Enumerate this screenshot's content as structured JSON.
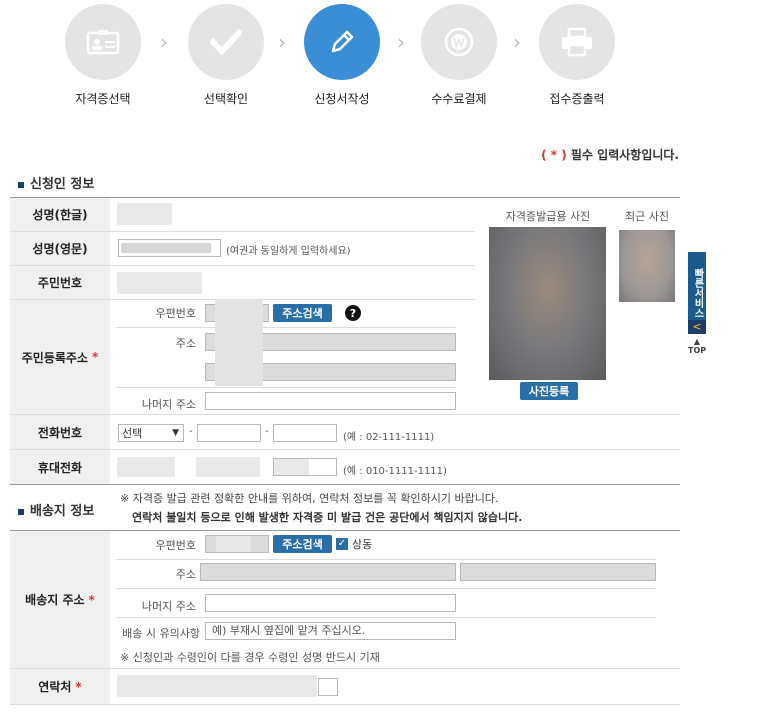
{
  "steps": [
    {
      "label": "자격증선택",
      "icon": "id-card-icon"
    },
    {
      "label": "선택확인",
      "icon": "check-icon"
    },
    {
      "label": "신청서작성",
      "icon": "pencil-icon"
    },
    {
      "label": "수수료결제",
      "icon": "won-coin-icon"
    },
    {
      "label": "접수증출력",
      "icon": "printer-icon"
    }
  ],
  "chevron": "›",
  "required_note": {
    "star": "( * )",
    "text": " 필수 입력사항입니다."
  },
  "applicant": {
    "title": "신청인 정보",
    "name_kr_label": "성명(한글)",
    "name_en_label": "성명(영문)",
    "name_en_hint": "(여권과 동일하게 입력하세요)",
    "rrn_label": "주민번호",
    "address_label": "주민등록주소",
    "postcode_label": "우편번호",
    "search_button": "주소검색",
    "help": "?",
    "address_sub_label": "주소",
    "rest_address_label": "나머지 주소",
    "phone_label": "전화번호",
    "phone_select": "선택",
    "phone_dash": "-",
    "phone_hint": "(예 : 02-111-1111)",
    "mobile_label": "휴대전화",
    "mobile_hint": "(예 : 010-1111-1111)"
  },
  "photos": {
    "issue_label": "자격증발급용 사진",
    "recent_label": "최근 사진",
    "register_button": "사진등록"
  },
  "delivery": {
    "title": "배송지 정보",
    "notice1": "※ 자격증 발급 관련 정확한 안내를 위하여, 연락처 정보를 꼭 확인하시기 바랍니다.",
    "notice2": "연락처 불일치 등으로 인해 발생한 자격증 미 발급 건은 공단에서 책임지지 않습니다.",
    "address_label": "배송지 주소",
    "postcode_label": "우편번호",
    "search_button": "주소검색",
    "same_label": "상동",
    "same_checked": true,
    "address_sub_label": "주소",
    "rest_address_label": "나머지 주소",
    "caution_label": "배송 시 유의사항",
    "caution_placeholder": "예) 부재시 옆집에 맡겨 주십시오.",
    "footnote": "※ 신청인과 수령인이 다를 경우 수령인 성명 반드시 기재",
    "contact_label": "연락처"
  },
  "required_star": "*",
  "quick_service": {
    "label": "빠른서비스",
    "arrow": "<",
    "top": "TOP"
  }
}
